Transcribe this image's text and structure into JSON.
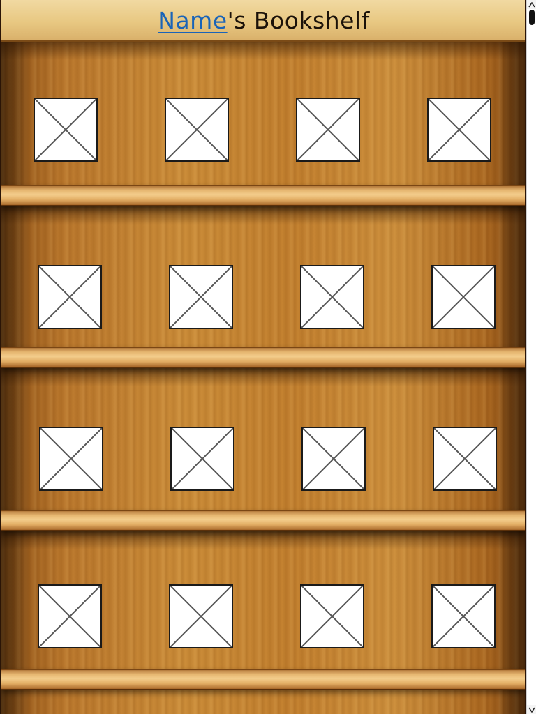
{
  "header": {
    "name_link": "Name",
    "title_suffix": "'s Bookshelf"
  },
  "colors": {
    "link": "#1a64b8",
    "wood": "#c98a36",
    "plank": "#f3cd8c"
  },
  "shelves": [
    {
      "books": [
        {
          "icon": "broken-image-icon"
        },
        {
          "icon": "broken-image-icon"
        },
        {
          "icon": "broken-image-icon"
        },
        {
          "icon": "broken-image-icon"
        }
      ]
    },
    {
      "books": [
        {
          "icon": "broken-image-icon"
        },
        {
          "icon": "broken-image-icon"
        },
        {
          "icon": "broken-image-icon"
        },
        {
          "icon": "broken-image-icon"
        }
      ]
    },
    {
      "books": [
        {
          "icon": "broken-image-icon"
        },
        {
          "icon": "broken-image-icon"
        },
        {
          "icon": "broken-image-icon"
        },
        {
          "icon": "broken-image-icon"
        }
      ]
    },
    {
      "books": [
        {
          "icon": "broken-image-icon"
        },
        {
          "icon": "broken-image-icon"
        },
        {
          "icon": "broken-image-icon"
        },
        {
          "icon": "broken-image-icon"
        }
      ]
    }
  ],
  "scrollbar": {
    "up_icon": "arrow-up-icon",
    "down_icon": "arrow-down-icon"
  }
}
